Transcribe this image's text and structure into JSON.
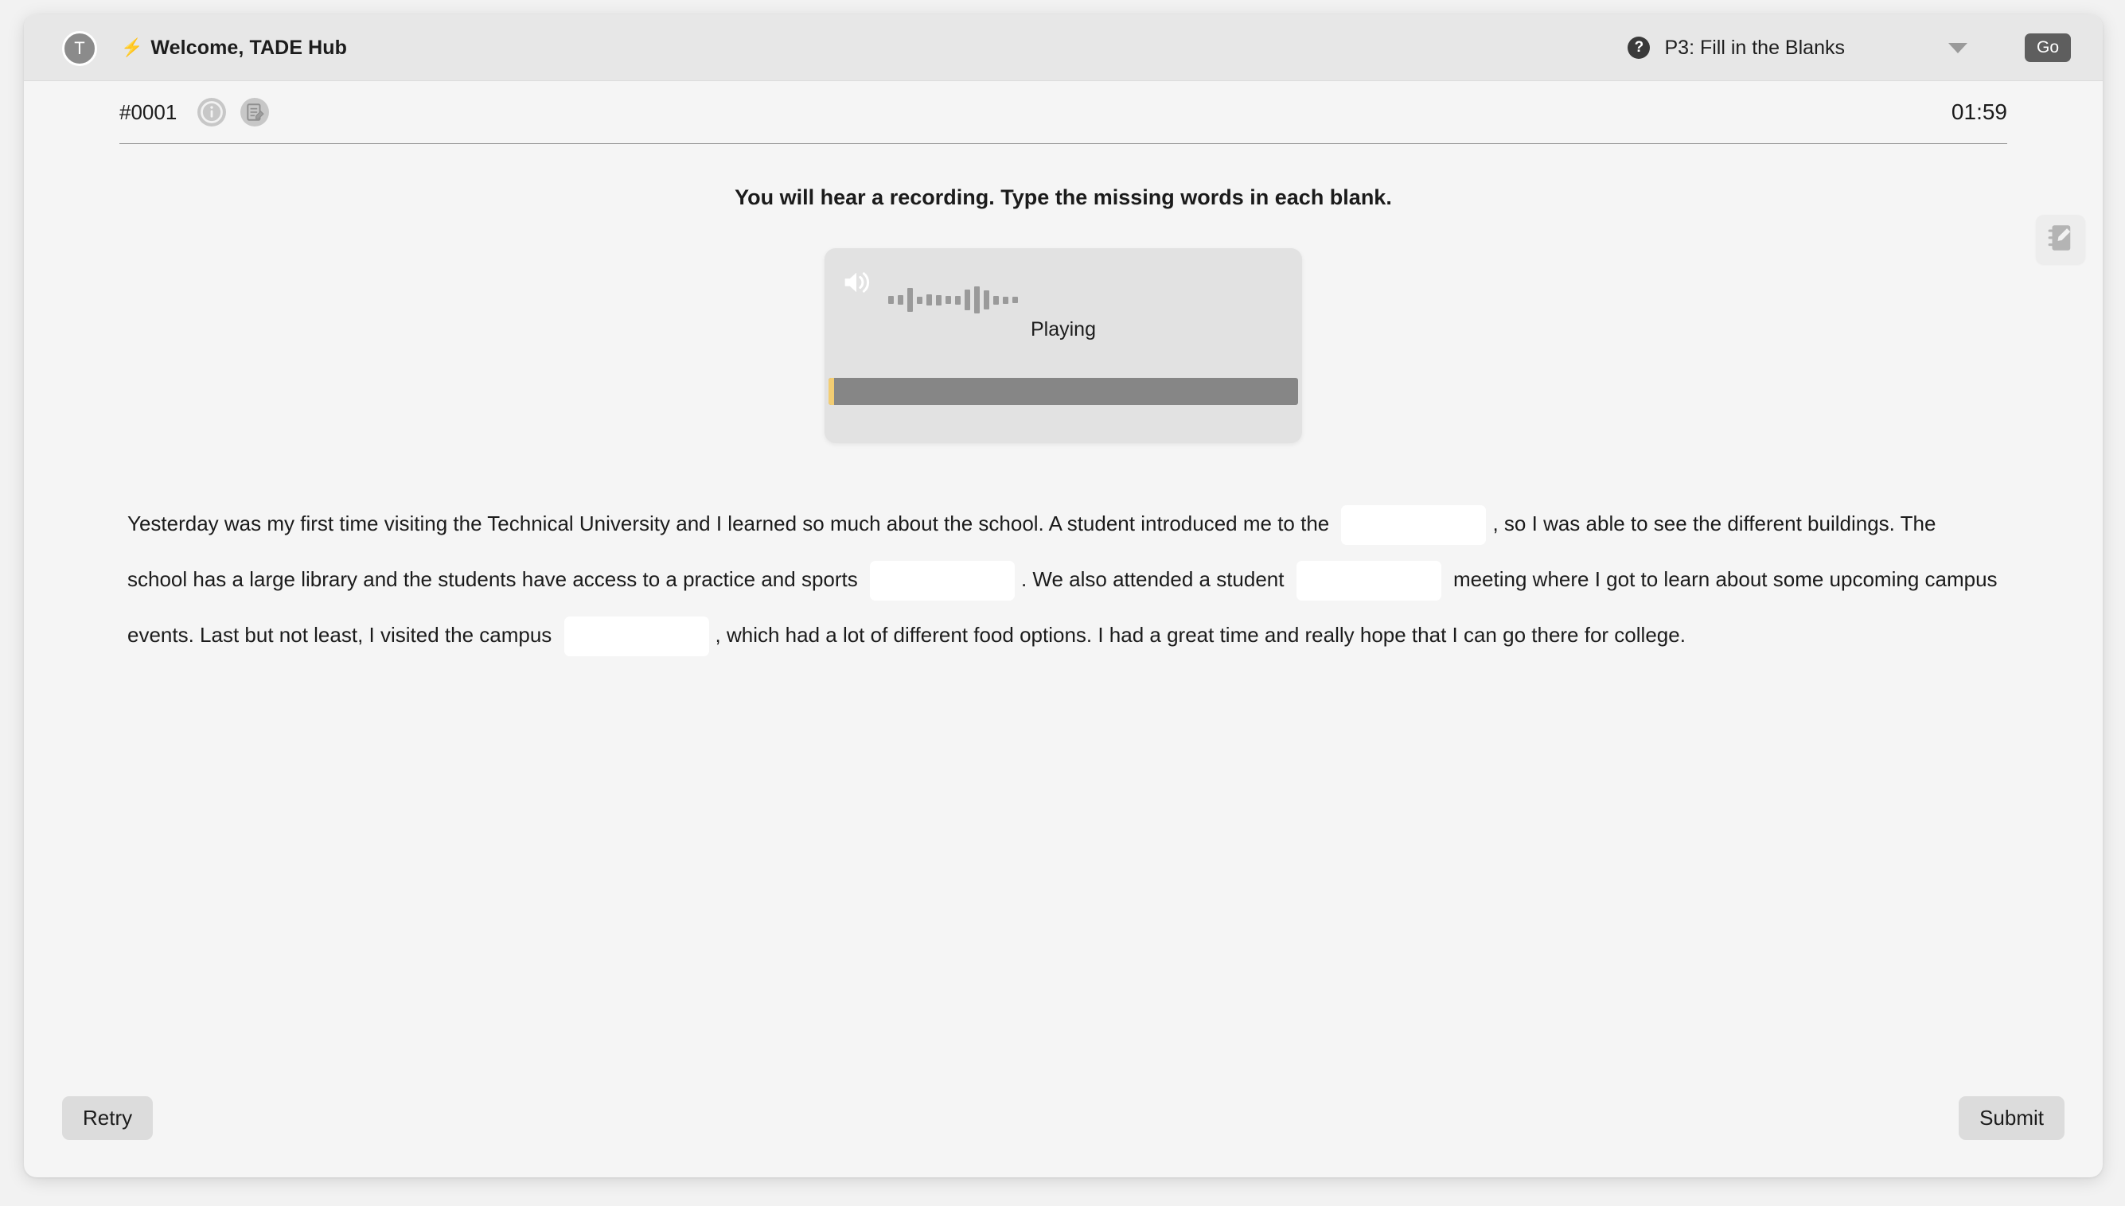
{
  "topbar": {
    "avatar_initial": "T",
    "bolt_icon": "lightning-bolt-icon",
    "welcome_text": "Welcome, TADE Hub",
    "help_icon": "question-mark-circle-icon",
    "activity_select_value": "P3: Fill in the Blanks",
    "chevron_icon": "chevron-down-icon",
    "go_label": "Go"
  },
  "meta": {
    "question_id": "#0001",
    "info_icon": "info-circle-icon",
    "notes_icon": "note-edit-icon",
    "timer": "01:59"
  },
  "floating": {
    "notes_icon": "notebook-pencil-icon"
  },
  "main": {
    "instruction": "You will hear a recording. Type the missing words in each blank."
  },
  "audio": {
    "speaker_icon": "speaker-volume-icon",
    "status": "Playing",
    "progress_percent": 1.2,
    "waveform_bars": [
      10,
      12,
      30,
      9,
      14,
      13,
      10,
      11,
      26,
      34,
      24,
      11,
      9,
      8
    ],
    "progress_fill_color": "#f3cd72",
    "progress_track_color": "#868686"
  },
  "passage": {
    "segments": [
      {
        "type": "text",
        "value": "Yesterday was my first time visiting the Technical University and I learned so much about the school. A student introduced me to the "
      },
      {
        "type": "blank",
        "index": 1,
        "value": "",
        "placeholder": ""
      },
      {
        "type": "text",
        "value": ", so I was able to see the different buildings. The school has a large library and the students have access to a practice and sports "
      },
      {
        "type": "blank",
        "index": 2,
        "value": "",
        "placeholder": ""
      },
      {
        "type": "text",
        "value": ". We also attended a student "
      },
      {
        "type": "blank",
        "index": 3,
        "value": "",
        "placeholder": ""
      },
      {
        "type": "text",
        "value": " meeting where I got to learn about some upcoming campus events. Last but not least, I visited the campus "
      },
      {
        "type": "blank",
        "index": 4,
        "value": "",
        "placeholder": ""
      },
      {
        "type": "text",
        "value": ", which had a lot of different food options. I had a great time and really hope that I can go there for college."
      }
    ]
  },
  "footer": {
    "retry_label": "Retry",
    "submit_label": "Submit"
  }
}
